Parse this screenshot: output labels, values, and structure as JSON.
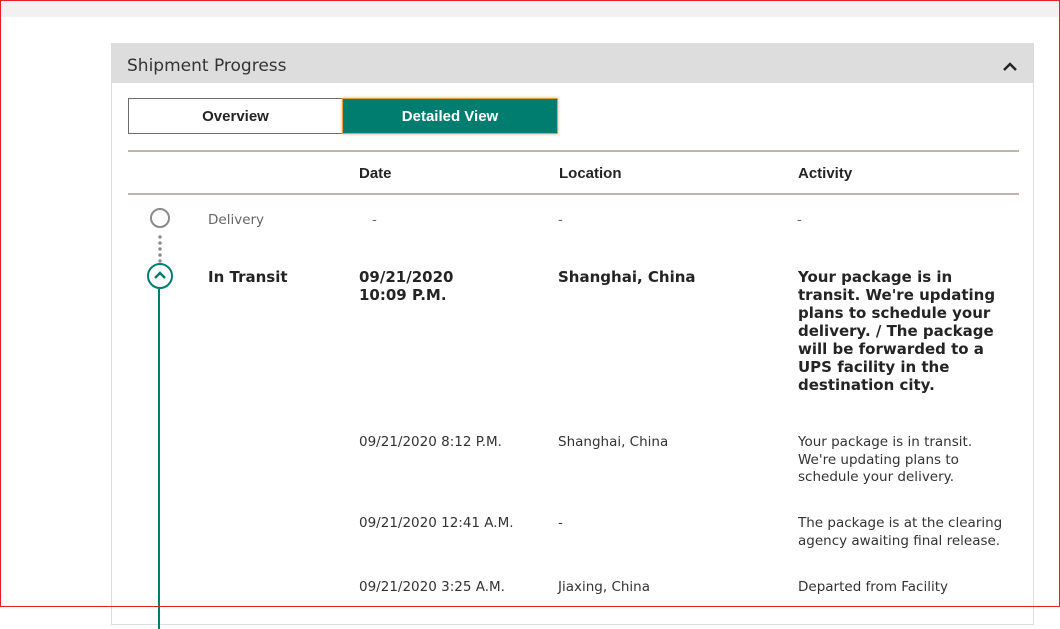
{
  "panel": {
    "title": "Shipment Progress",
    "collapse_icon": "chevron-up-icon"
  },
  "toggle": {
    "overview_label": "Overview",
    "detailed_label": "Detailed View",
    "active": "Detailed View",
    "active_color": "#007d6f"
  },
  "table": {
    "headers": {
      "date": "Date",
      "location": "Location",
      "activity": "Activity"
    },
    "delivery": {
      "status": "Delivery",
      "date": "-",
      "location": "-",
      "activity": "-"
    },
    "in_transit": {
      "status": "In Transit",
      "date_line1": "09/21/2020",
      "date_line2": "10:09 P.M.",
      "location": "Shanghai, China",
      "activity": "Your package is in transit. We're updating plans to schedule your delivery. / The package will be forwarded to a UPS facility in the destination city."
    },
    "events": [
      {
        "date": "09/21/2020  8:12 P.M.",
        "location": "Shanghai, China",
        "activity": "Your package is in transit. We're updating plans to schedule your delivery."
      },
      {
        "date": "09/21/2020  12:41 A.M.",
        "location": "-",
        "activity": "The package is at the clearing agency awaiting final release."
      },
      {
        "date": "09/21/2020  3:25 A.M.",
        "location": "Jiaxing, China",
        "activity": "Departed from Facility"
      }
    ]
  }
}
